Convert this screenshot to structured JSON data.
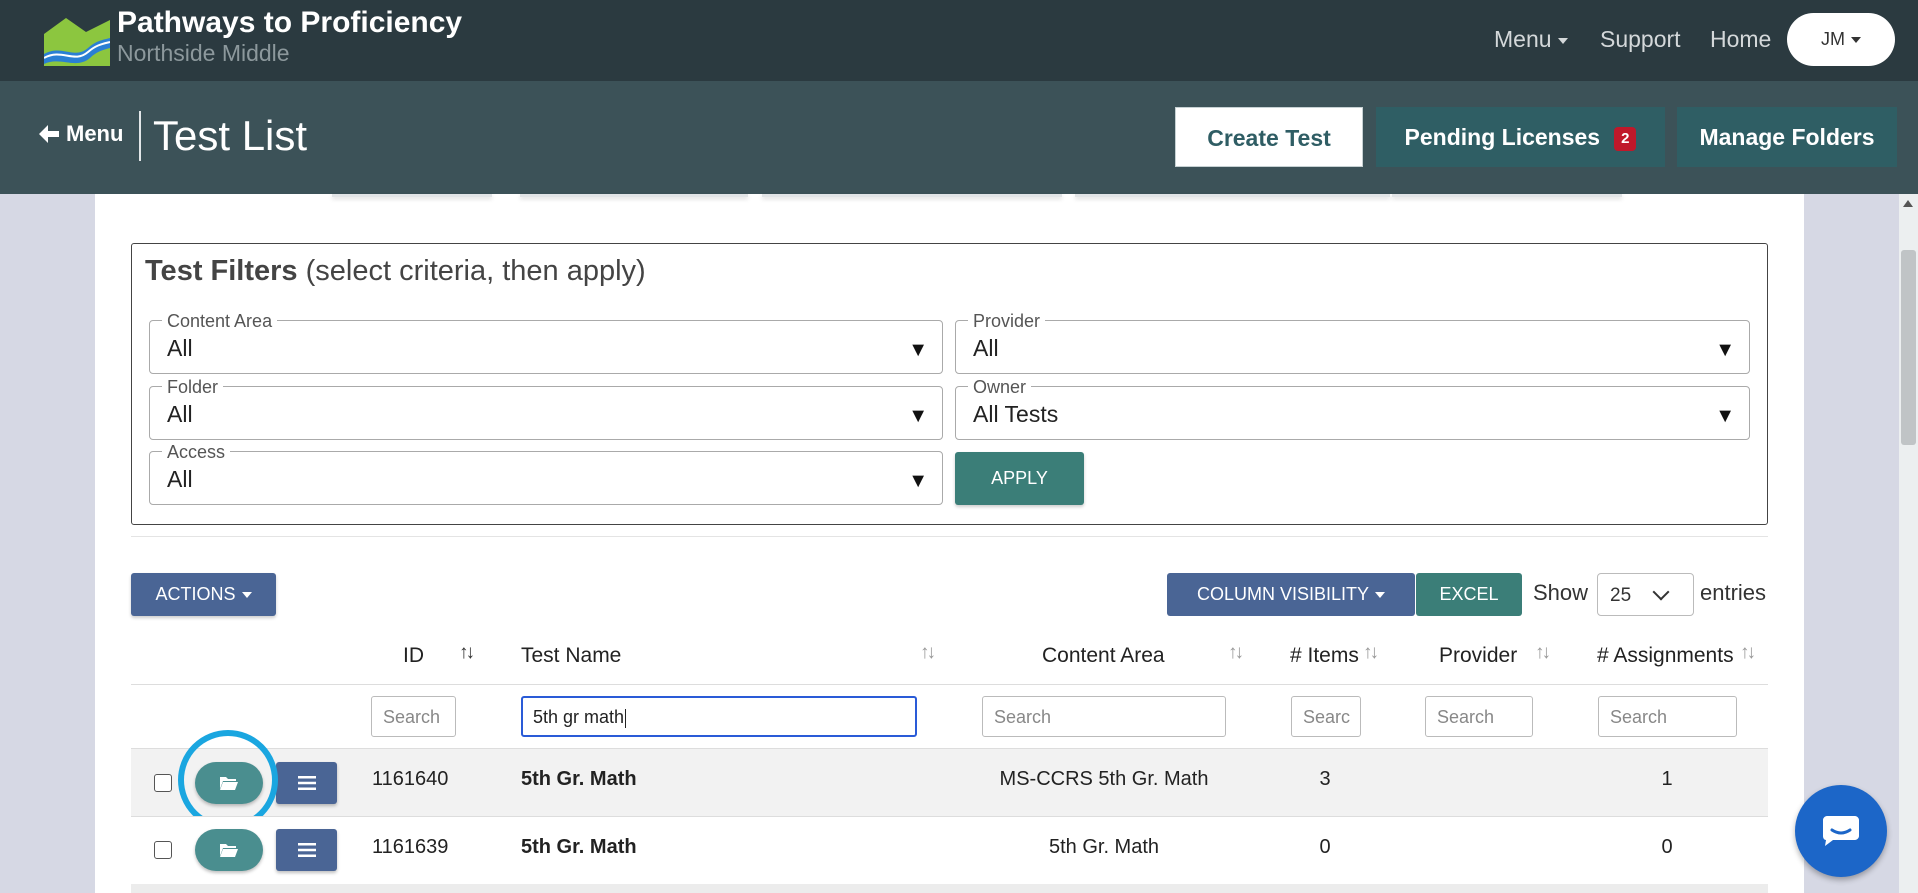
{
  "brand": {
    "title": "Pathways to Proficiency",
    "subtitle": "Northside Middle"
  },
  "topnav": {
    "menu": "Menu",
    "support": "Support",
    "home": "Home",
    "user_initials": "JM"
  },
  "header": {
    "back_label": "Menu",
    "title": "Test List",
    "create_test": "Create Test",
    "pending_licenses": "Pending Licenses",
    "pending_count": "2",
    "manage_folders": "Manage Folders"
  },
  "filters": {
    "heading_bold": "Test Filters",
    "heading_rest": "(select criteria, then apply)",
    "content_area": {
      "label": "Content Area",
      "value": "All"
    },
    "provider": {
      "label": "Provider",
      "value": "All"
    },
    "folder": {
      "label": "Folder",
      "value": "All"
    },
    "owner": {
      "label": "Owner",
      "value": "All Tests"
    },
    "access": {
      "label": "Access",
      "value": "All"
    },
    "apply": "APPLY"
  },
  "toolbar": {
    "actions": "ACTIONS",
    "column_visibility": "COLUMN VISIBILITY",
    "excel": "EXCEL",
    "show": "Show",
    "entries_value": "25",
    "entries": "entries"
  },
  "table": {
    "columns": {
      "id": "ID",
      "test_name": "Test Name",
      "content_area": "Content Area",
      "items": "# Items",
      "provider": "Provider",
      "assignments": "# Assignments"
    },
    "search": {
      "placeholder": "Search",
      "items_placeholder": "Searc",
      "test_name_value": "5th gr math"
    },
    "rows": [
      {
        "id": "1161640",
        "test_name": "5th Gr. Math",
        "content_area": "MS-CCRS 5th Gr. Math",
        "items": "3",
        "provider": "",
        "assignments": "1"
      },
      {
        "id": "1161639",
        "test_name": "5th Gr. Math",
        "content_area": "5th Gr. Math",
        "items": "0",
        "provider": "",
        "assignments": "0"
      }
    ]
  },
  "colors": {
    "topbar": "#2b3a40",
    "headerbar": "#3c5258",
    "teal": "#3b7e78",
    "blue": "#4a6595",
    "highlight": "#1aa6e0",
    "chat": "#1c66c8"
  },
  "icons": {
    "back": "arrow-left-icon",
    "folder": "folder-open-icon",
    "menu": "hamburger-icon",
    "chat": "chat-icon"
  }
}
